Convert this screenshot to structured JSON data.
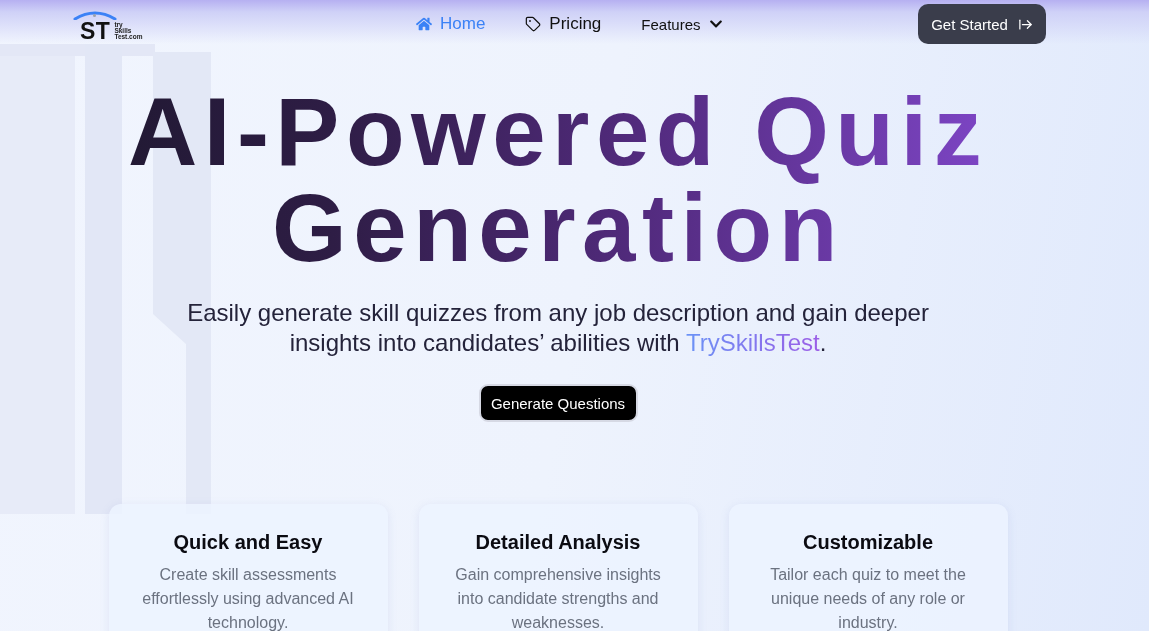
{
  "header": {
    "logo": {
      "mark": "ST",
      "tagline": [
        "try",
        "Skills",
        "Test.com"
      ]
    },
    "nav": [
      {
        "kind": "link",
        "label": "Home",
        "selected": true
      },
      {
        "kind": "link",
        "label": "Pricing",
        "selected": false
      },
      {
        "kind": "dropdown",
        "label": "Features",
        "selected": false
      }
    ],
    "cta": "Get Started"
  },
  "hero": {
    "title": "AI-Powered Quiz Generation",
    "subtitle": [
      {
        "kind": "plain",
        "text": "Easily generate skill quizzes from any job description and gain deeper insights into candidates’ abilities with "
      },
      {
        "kind": "brand",
        "text": "TrySkillsTest"
      },
      {
        "kind": "plain",
        "text": "."
      }
    ],
    "button": "Generate Questions"
  },
  "features": [
    {
      "title": "Quick and Easy",
      "description": "Create skill assessments effortlessly using advanced AI technology."
    },
    {
      "title": "Detailed Analysis",
      "description": "Gain comprehensive insights into candidate strengths and weaknesses."
    },
    {
      "title": "Customizable",
      "description": "Tailor each quiz to meet the unique needs of any role or industry."
    }
  ]
}
